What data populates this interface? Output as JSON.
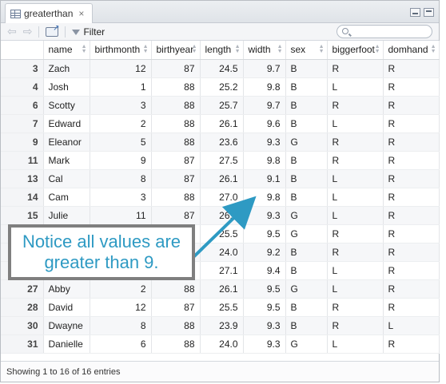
{
  "tab": {
    "title": "greaterthan",
    "close_glyph": "×"
  },
  "toolbar": {
    "back_glyph": "⇦",
    "forward_glyph": "⇨",
    "filter_label": "Filter",
    "search_placeholder": ""
  },
  "table": {
    "columns": [
      "name",
      "birthmonth",
      "birthyear",
      "length",
      "width",
      "sex",
      "biggerfoot",
      "domhand"
    ],
    "rows": [
      {
        "id": "3",
        "name": "Zach",
        "birthmonth": "12",
        "birthyear": "87",
        "length": "24.5",
        "width": "9.7",
        "sex": "B",
        "biggerfoot": "R",
        "domhand": "R"
      },
      {
        "id": "4",
        "name": "Josh",
        "birthmonth": "1",
        "birthyear": "88",
        "length": "25.2",
        "width": "9.8",
        "sex": "B",
        "biggerfoot": "L",
        "domhand": "R"
      },
      {
        "id": "6",
        "name": "Scotty",
        "birthmonth": "3",
        "birthyear": "88",
        "length": "25.7",
        "width": "9.7",
        "sex": "B",
        "biggerfoot": "R",
        "domhand": "R"
      },
      {
        "id": "7",
        "name": "Edward",
        "birthmonth": "2",
        "birthyear": "88",
        "length": "26.1",
        "width": "9.6",
        "sex": "B",
        "biggerfoot": "L",
        "domhand": "R"
      },
      {
        "id": "9",
        "name": "Eleanor",
        "birthmonth": "5",
        "birthyear": "88",
        "length": "23.6",
        "width": "9.3",
        "sex": "G",
        "biggerfoot": "R",
        "domhand": "R"
      },
      {
        "id": "11",
        "name": "Mark",
        "birthmonth": "9",
        "birthyear": "87",
        "length": "27.5",
        "width": "9.8",
        "sex": "B",
        "biggerfoot": "R",
        "domhand": "R"
      },
      {
        "id": "13",
        "name": "Cal",
        "birthmonth": "8",
        "birthyear": "87",
        "length": "26.1",
        "width": "9.1",
        "sex": "B",
        "biggerfoot": "L",
        "domhand": "R"
      },
      {
        "id": "14",
        "name": "Cam",
        "birthmonth": "3",
        "birthyear": "88",
        "length": "27.0",
        "width": "9.8",
        "sex": "B",
        "biggerfoot": "L",
        "domhand": "R"
      },
      {
        "id": "15",
        "name": "Julie",
        "birthmonth": "11",
        "birthyear": "87",
        "length": "26.0",
        "width": "9.3",
        "sex": "G",
        "biggerfoot": "L",
        "domhand": "R"
      },
      {
        "id": "",
        "name": "",
        "birthmonth": "",
        "birthyear": "",
        "length": "25.5",
        "width": "9.5",
        "sex": "G",
        "biggerfoot": "R",
        "domhand": "R"
      },
      {
        "id": "",
        "name": "",
        "birthmonth": "",
        "birthyear": "",
        "length": "24.0",
        "width": "9.2",
        "sex": "B",
        "biggerfoot": "R",
        "domhand": "R"
      },
      {
        "id": "",
        "name": "",
        "birthmonth": "",
        "birthyear": "",
        "length": "27.1",
        "width": "9.4",
        "sex": "B",
        "biggerfoot": "L",
        "domhand": "R"
      },
      {
        "id": "27",
        "name": "Abby",
        "birthmonth": "2",
        "birthyear": "88",
        "length": "26.1",
        "width": "9.5",
        "sex": "G",
        "biggerfoot": "L",
        "domhand": "R"
      },
      {
        "id": "28",
        "name": "David",
        "birthmonth": "12",
        "birthyear": "87",
        "length": "25.5",
        "width": "9.5",
        "sex": "B",
        "biggerfoot": "R",
        "domhand": "R"
      },
      {
        "id": "30",
        "name": "Dwayne",
        "birthmonth": "8",
        "birthyear": "88",
        "length": "23.9",
        "width": "9.3",
        "sex": "B",
        "biggerfoot": "R",
        "domhand": "L"
      },
      {
        "id": "31",
        "name": "Danielle",
        "birthmonth": "6",
        "birthyear": "88",
        "length": "24.0",
        "width": "9.3",
        "sex": "G",
        "biggerfoot": "L",
        "domhand": "R"
      }
    ]
  },
  "status": {
    "text": "Showing 1 to 16 of 16 entries"
  },
  "callout": {
    "text": "Notice all values are greater than 9."
  },
  "colors": {
    "callout_text": "#2e9ac3",
    "callout_border": "#7f7f7f",
    "arrow": "#2e9ac3"
  }
}
